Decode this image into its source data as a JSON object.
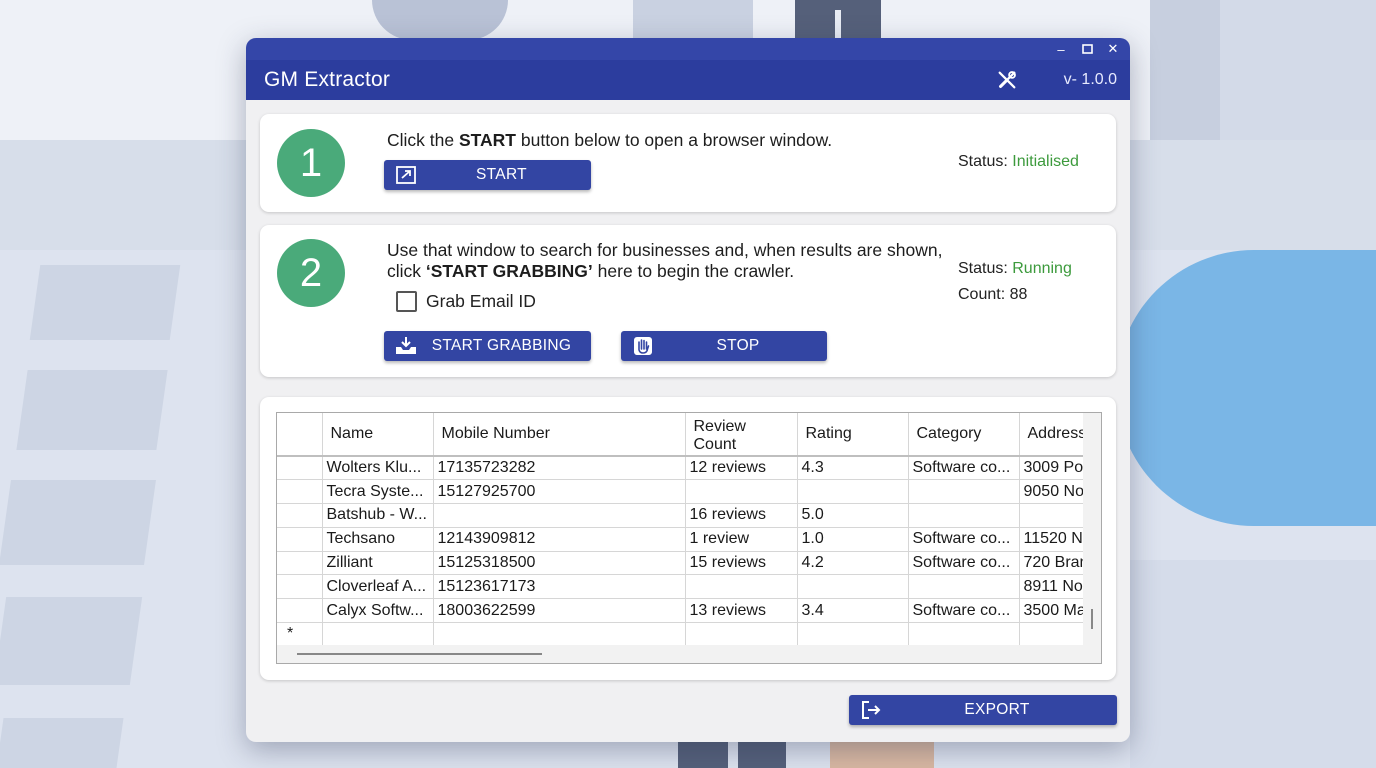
{
  "window": {
    "controls": {
      "minimize": "–",
      "maximize": "□",
      "close": "✕"
    },
    "title": "GM Extractor",
    "version": "v- 1.0.0",
    "settings_icon": "tools-icon"
  },
  "step1": {
    "number": "1",
    "text_before": "Click the ",
    "text_bold": "START",
    "text_after": " button below to open a browser window.",
    "button_label": "START",
    "button_icon": "open-external-icon",
    "status_label": "Status: ",
    "status_value": "Initialised"
  },
  "step2": {
    "number": "2",
    "line1": "Use that window to search for businesses and, when results are shown,",
    "line2_before": "click ",
    "line2_bold": "‘START GRABBING’",
    "line2_after": " here to begin the crawler.",
    "checkbox_label": "Grab Email ID",
    "checkbox_checked": false,
    "grab_button_label": "START GRABBING",
    "grab_button_icon": "download-tray-icon",
    "stop_button_label": "STOP",
    "stop_button_icon": "hand-stop-icon",
    "status_label": "Status: ",
    "status_value": "Running",
    "count_label": "Count: ",
    "count_value": "88"
  },
  "table": {
    "columns": [
      "Name",
      "Mobile Number",
      "Review\nCount",
      "Rating",
      "Category",
      "Address"
    ],
    "rows": [
      [
        "Wolters Klu...",
        "17135723282",
        "12 reviews",
        "4.3",
        "Software co...",
        "3009 Po"
      ],
      [
        "Tecra Syste...",
        "15127925700",
        "",
        "",
        "",
        "9050 No"
      ],
      [
        "Batshub - W...",
        "",
        "16 reviews",
        "5.0",
        "",
        ""
      ],
      [
        "Techsano",
        "12143909812",
        "1 review",
        "1.0",
        "Software co...",
        "11520 N"
      ],
      [
        "Zilliant",
        "15125318500",
        "15 reviews",
        "4.2",
        "Software co...",
        "720 Bran"
      ],
      [
        "Cloverleaf A...",
        "15123617173",
        "",
        "",
        "",
        "8911 No"
      ],
      [
        "Calyx Softw...",
        "18003622599",
        "13 reviews",
        "3.4",
        "Software co...",
        "3500 Ma"
      ]
    ],
    "new_row_marker": "*"
  },
  "export": {
    "label": "EXPORT",
    "icon": "exit-arrow-icon"
  },
  "colors": {
    "header": "#2c3d9e",
    "button": "#3345a3",
    "step_circle": "#4aaa7a",
    "status_green": "#3c9a3c"
  }
}
